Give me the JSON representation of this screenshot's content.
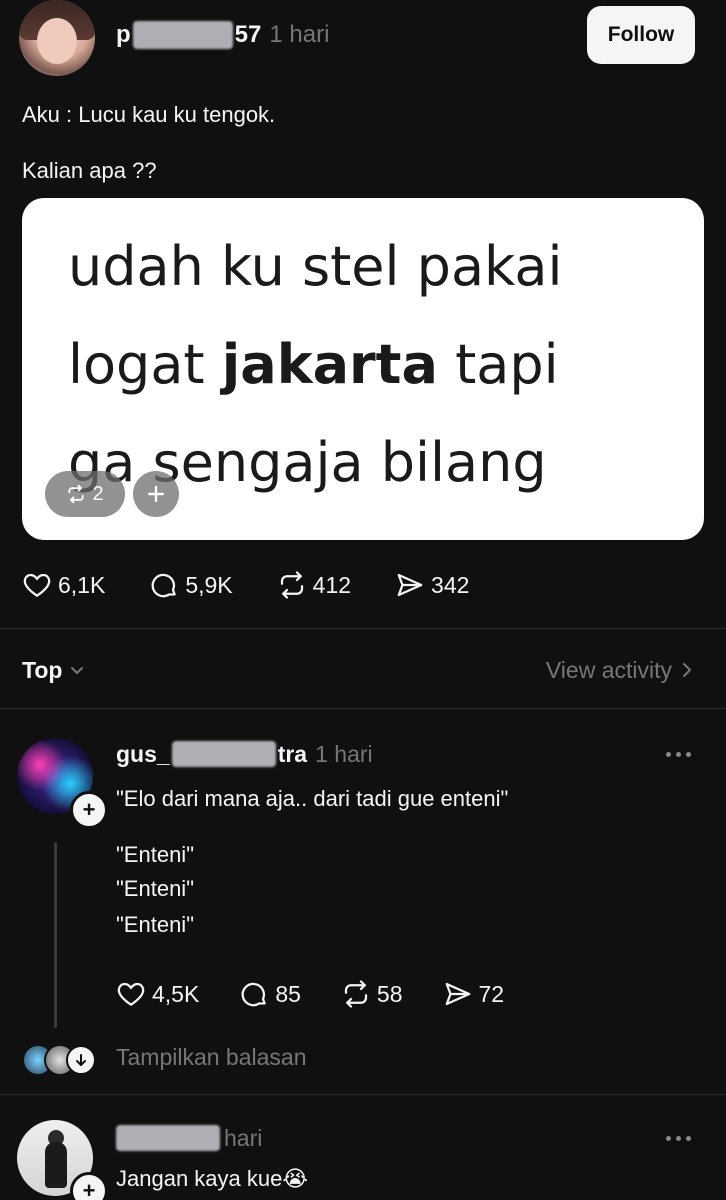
{
  "post": {
    "username_start": "p",
    "username_end": "57",
    "time": "1 hari",
    "follow_label": "Follow",
    "text_line1": "Aku : Lucu kau ku tengok.",
    "text_line2": "Kalian apa ??",
    "image_caption": {
      "line1": "udah ku stel pakai",
      "line2_pre": "logat ",
      "line2_bold": "jakarta",
      "line2_post": " tapi",
      "line3": "ga sengaja bilang"
    },
    "image_repost_count": "2",
    "image_plus_label": "+",
    "likes": "6,1K",
    "replies": "5,9K",
    "reposts": "412",
    "shares": "342"
  },
  "sort": {
    "label": "Top",
    "view_activity": "View activity"
  },
  "comments": [
    {
      "username_start": "gus_",
      "username_end": "tra",
      "time": "1 hari",
      "lines": [
        "\"Elo dari mana aja.. dari tadi gue enteni\"",
        "\"Enteni\"",
        "\"Enteni\"",
        "\"Enteni\""
      ],
      "likes": "4,5K",
      "replies": "85",
      "reposts": "58",
      "shares": "72",
      "show_replies": "Tampilkan balasan"
    },
    {
      "time": "hari",
      "text": "Jangan kaya kue😭"
    }
  ],
  "icons": {
    "heart": "heart-icon",
    "comment": "comment-icon",
    "repost": "repost-icon",
    "share": "share-icon",
    "more": "more-icon",
    "chevron": "chevron-down-icon"
  },
  "colors": {
    "background": "#101010",
    "text": "#f3f5f7",
    "muted": "#777777",
    "follow_button": "#f3f5f7"
  }
}
